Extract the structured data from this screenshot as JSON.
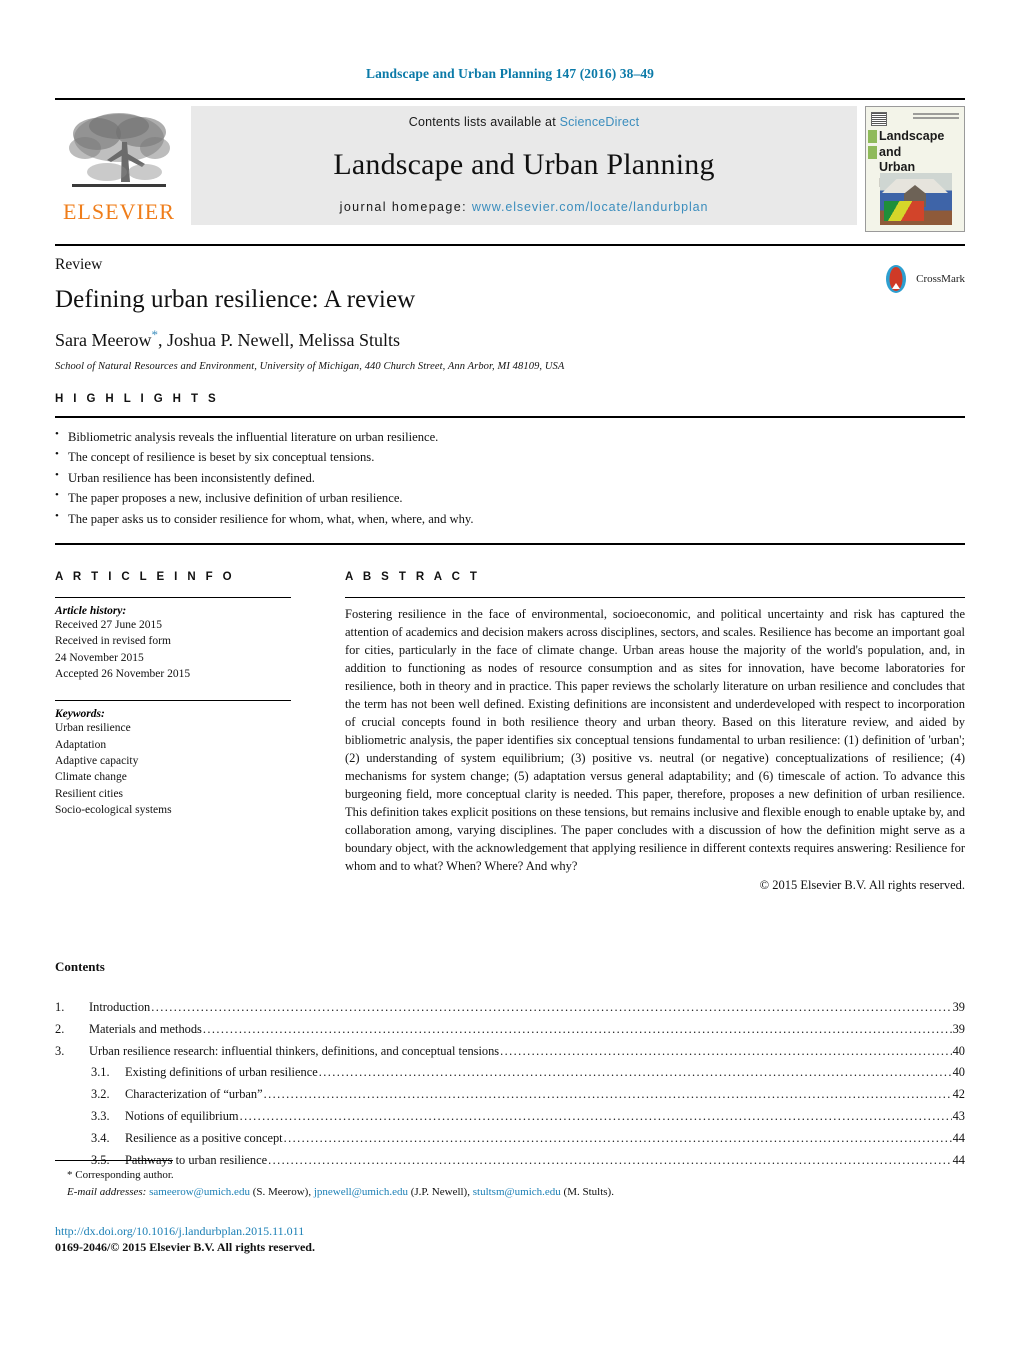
{
  "running_head": "Landscape and Urban Planning 147 (2016) 38–49",
  "masthead": {
    "publisher_logo_text": "ELSEVIER",
    "contents_prefix": "Contents lists available at",
    "contents_link": "ScienceDirect",
    "journal_name": "Landscape and Urban Planning",
    "homepage_prefix": "journal homepage:",
    "homepage_url": "www.elsevier.com/locate/landurbplan",
    "cover": {
      "title_line1": "Landscape and",
      "title_line2": "Urban Planning"
    }
  },
  "article": {
    "kind": "Review",
    "title": "Defining urban resilience: A review",
    "authors": "Sara Meerow",
    "authors_rest": ", Joshua P. Newell, Melissa Stults",
    "corresponding_marker": "*",
    "affiliation": "School of Natural Resources and Environment, University of Michigan, 440 Church Street, Ann Arbor, MI 48109, USA",
    "crossmark_label": "CrossMark"
  },
  "highlights": {
    "label": "H I G H L I G H T S",
    "items": [
      "Bibliometric analysis reveals the influential literature on urban resilience.",
      "The concept of resilience is beset by six conceptual tensions.",
      "Urban resilience has been inconsistently defined.",
      "The paper proposes a new, inclusive definition of urban resilience.",
      "The paper asks us to consider resilience for whom, what, when, where, and why."
    ]
  },
  "article_info": {
    "label": "A R T I C L E   I N F O",
    "history_head": "Article history:",
    "history_lines": [
      "Received 27 June 2015",
      "Received in revised form",
      "24 November 2015",
      "Accepted 26 November 2015"
    ],
    "keywords_head": "Keywords:",
    "keywords": [
      "Urban resilience",
      "Adaptation",
      "Adaptive capacity",
      "Climate change",
      "Resilient cities",
      "Socio-ecological systems"
    ]
  },
  "abstract": {
    "label": "A B S T R A C T",
    "body": "Fostering resilience in the face of environmental, socioeconomic, and political uncertainty and risk has captured the attention of academics and decision makers across disciplines, sectors, and scales. Resilience has become an important goal for cities, particularly in the face of climate change. Urban areas house the majority of the world's population, and, in addition to functioning as nodes of resource consumption and as sites for innovation, have become laboratories for resilience, both in theory and in practice. This paper reviews the scholarly literature on urban resilience and concludes that the term has not been well defined. Existing definitions are inconsistent and underdeveloped with respect to incorporation of crucial concepts found in both resilience theory and urban theory. Based on this literature review, and aided by bibliometric analysis, the paper identifies six conceptual tensions fundamental to urban resilience: (1) definition of 'urban'; (2) understanding of system equilibrium; (3) positive vs. neutral (or negative) conceptualizations of resilience; (4) mechanisms for system change; (5) adaptation versus general adaptability; and (6) timescale of action. To advance this burgeoning field, more conceptual clarity is needed. This paper, therefore, proposes a new definition of urban resilience. This definition takes explicit positions on these tensions, but remains inclusive and flexible enough to enable uptake by, and collaboration among, varying disciplines. The paper concludes with a discussion of how the definition might serve as a boundary object, with the acknowledgement that applying resilience in different contexts requires answering: Resilience for whom and to what? When? Where? And why?",
    "copyright": "© 2015 Elsevier B.V. All rights reserved."
  },
  "contents": {
    "heading": "Contents",
    "entries": [
      {
        "num": "1.",
        "label": "Introduction",
        "page": "39",
        "sub": false
      },
      {
        "num": "2.",
        "label": "Materials and methods",
        "page": "39",
        "sub": false
      },
      {
        "num": "3.",
        "label": "Urban resilience research: influential thinkers, definitions, and conceptual tensions",
        "page": "40",
        "sub": false
      },
      {
        "num": "3.1.",
        "label": "Existing definitions of urban resilience",
        "page": "40",
        "sub": true
      },
      {
        "num": "3.2.",
        "label": "Characterization of “urban”",
        "page": "42",
        "sub": true
      },
      {
        "num": "3.3.",
        "label": "Notions of equilibrium",
        "page": "43",
        "sub": true
      },
      {
        "num": "3.4.",
        "label": "Resilience as a positive concept",
        "page": "44",
        "sub": true
      },
      {
        "num": "3.5.",
        "label": "Pathways to urban resilience",
        "page": "44",
        "sub": true
      }
    ]
  },
  "footer": {
    "corresponding_marker": "*",
    "corresponding_text": "Corresponding author.",
    "email_label": "E-mail addresses:",
    "emails": [
      {
        "address": "sameerow@umich.edu",
        "owner": "(S. Meerow)"
      },
      {
        "address": "jpnewell@umich.edu",
        "owner": "(J.P. Newell)"
      },
      {
        "address": "stultsm@umich.edu",
        "owner": "(M. Stults)"
      }
    ],
    "doi": "http://dx.doi.org/10.1016/j.landurbplan.2015.11.011",
    "issn": "0169-2046/© 2015 Elsevier B.V. All rights reserved."
  }
}
